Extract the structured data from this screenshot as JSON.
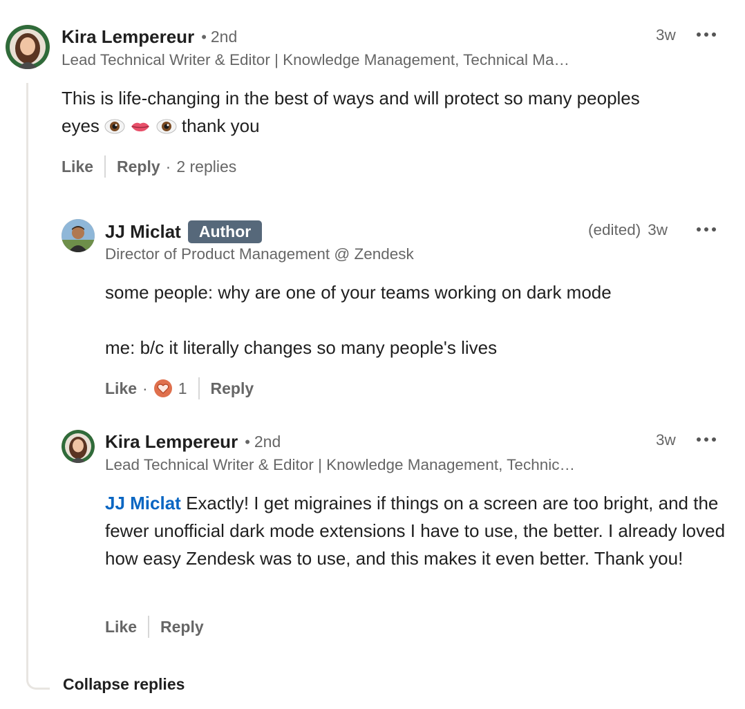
{
  "comments": [
    {
      "name": "Kira Lempereur",
      "degree": "2nd",
      "headline": "Lead Technical Writer & Editor | Knowledge Management, Technical Ma…",
      "time": "3w",
      "text_line1": "This is life-changing in the best of ways and will protect so many peoples",
      "text_prefix": "eyes",
      "text_suffix": "thank you",
      "like": "Like",
      "reply": "Reply",
      "replies": "2 replies"
    },
    {
      "name": "JJ Miclat",
      "badge": "Author",
      "headline": "Director of Product Management @ Zendesk",
      "edited": "(edited)",
      "time": "3w",
      "text_line1": "some people: why are one of your teams working on dark mode",
      "text_line2": "me: b/c it literally changes so many people's lives",
      "like": "Like",
      "reaction_count": "1",
      "reply": "Reply"
    },
    {
      "name": "Kira Lempereur",
      "degree": "2nd",
      "headline": "Lead Technical Writer & Editor | Knowledge Management, Technic…",
      "time": "3w",
      "mention": "JJ Miclat",
      "text": "Exactly! I get migraines if things on a screen are too bright, and the fewer unofficial dark mode extensions I have to use, the better. I already loved how easy Zendesk was to use, and this makes it even better. Thank you!",
      "like": "Like",
      "reply": "Reply"
    }
  ],
  "collapse_label": "Collapse replies",
  "colors": {
    "mention": "#0a66c2",
    "author_badge": "#56687a",
    "secondary_text": "#666666"
  },
  "icons": [
    "eye-emoji",
    "lips-emoji",
    "heart-reaction-icon",
    "more-options-icon"
  ]
}
